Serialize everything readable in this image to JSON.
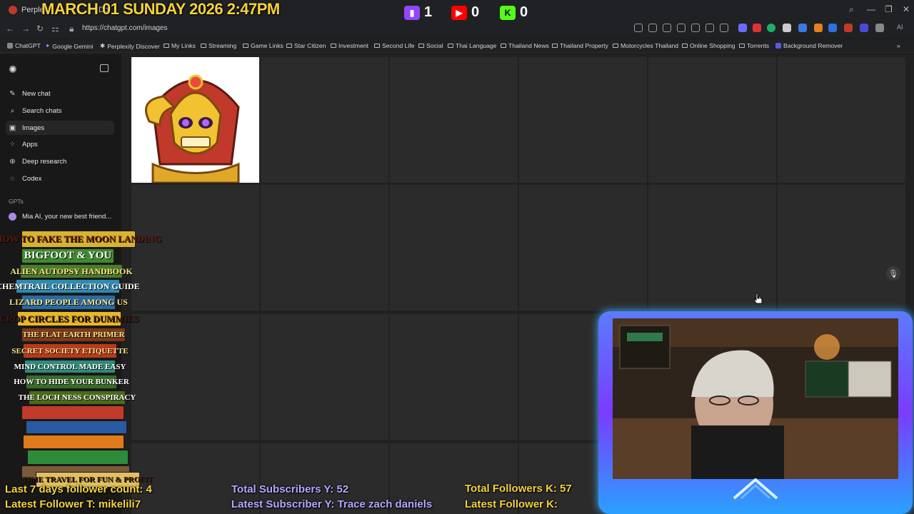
{
  "tabs": {
    "first": "Perplexi",
    "second": "Do"
  },
  "overlay": {
    "datetime": "MARCH 01 SUNDAY 2026 2:47PM",
    "twitch_count": "1",
    "youtube_count": "0",
    "kick_count": "0"
  },
  "address": {
    "url": "https://chatgpt.com/images"
  },
  "bookmarks": [
    "ChatGPT",
    "Google Gemini",
    "Perplexity Discover",
    "My Links",
    "Streaming",
    "Game Links",
    "Star Citizen",
    "Investment",
    "Second Life",
    "Social",
    "Thai Language",
    "Thailand News",
    "Thailand Property",
    "Motorcycles Thailand",
    "Online Shopping",
    "Torrents",
    "Background Remover"
  ],
  "sidebar": {
    "items": [
      "New chat",
      "Search chats",
      "Images",
      "Apps",
      "Deep research",
      "Codex"
    ],
    "gpts_label": "GPTs",
    "gpt_item": "Mia AI, your new best friend..."
  },
  "books": [
    "HOW TO FAKE THE MOON LANDING",
    "BIGFOOT & YOU",
    "ALIEN AUTOPSY HANDBOOK",
    "CHEMTRAIL COLLECTION GUIDE",
    "LIZARD PEOPLE AMONG US",
    "CROP CIRCLES FOR DUMMIES",
    "THE FLAT EARTH PRIMER",
    "SECRET SOCIETY ETIQUETTE",
    "MIND CONTROL MADE EASY",
    "HOW TO HIDE YOUR BUNKER",
    "THE LOCH NESS CONSPIRACY",
    "TIME TRAVEL FOR FUN & PROFIT"
  ],
  "footer": {
    "followers_7d": "Last 7 days follower count: 4",
    "latest_follower_t": "Latest Follower T: mikelili7",
    "total_subs_y": "Total Subscribers Y: 52",
    "latest_sub_y": "Latest Subscriber Y: Trace zach daniels",
    "total_followers_k": "Total Followers K: 57",
    "latest_follower_k": "Latest Follower K:"
  },
  "colors": {
    "accent_yellow": "#f6d23a",
    "footer_purple": "#b7a6ff",
    "twitch": "#9146ff",
    "youtube": "#ff0000",
    "kick": "#53fc18"
  }
}
